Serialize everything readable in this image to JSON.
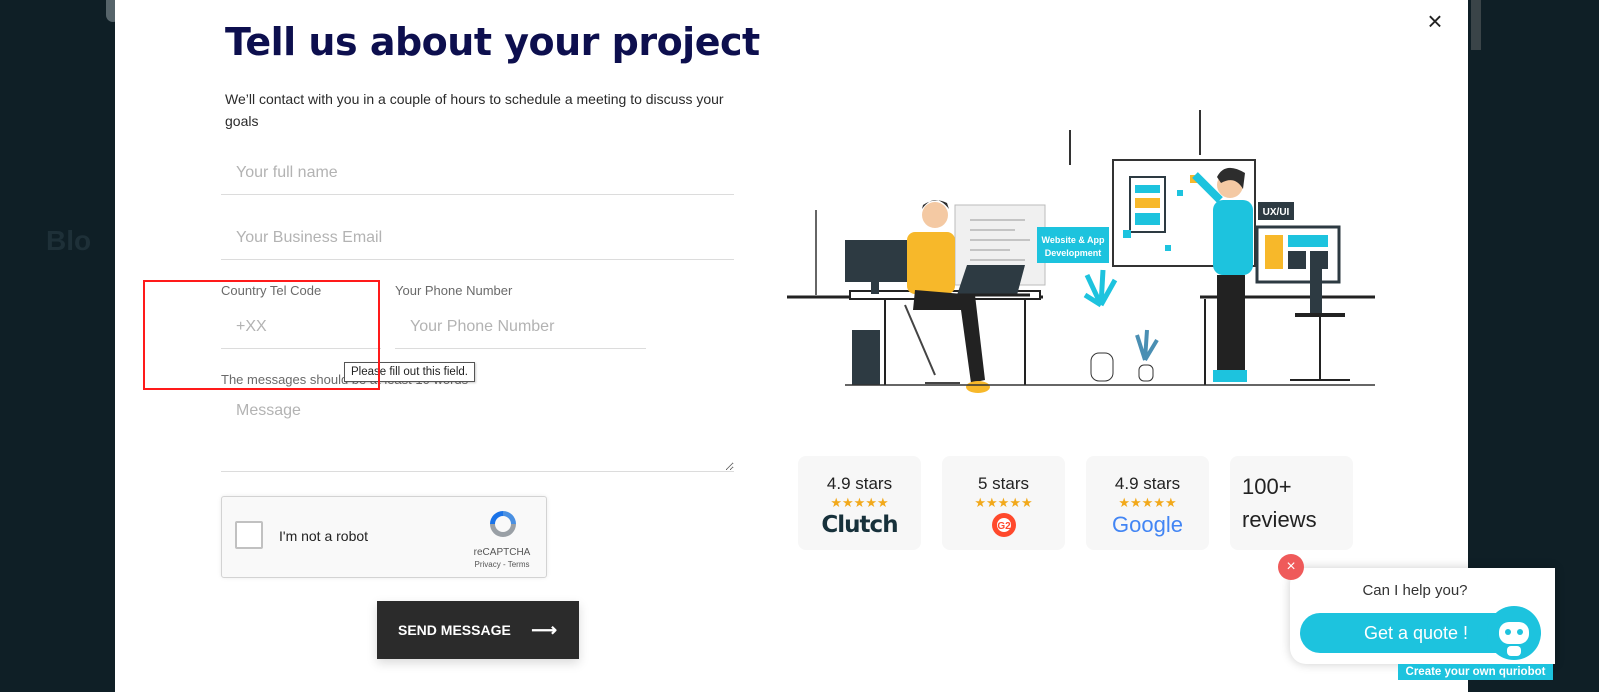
{
  "backdrop": {
    "partial_text": "Blo"
  },
  "modal": {
    "close_icon": "×",
    "title": "Tell us about your project",
    "subtitle": "We’ll contact with you in a couple of hours to schedule a meeting to discuss your goals"
  },
  "form": {
    "full_name_placeholder": "Your full name",
    "email_placeholder": "Your Business Email",
    "country_code_label": "Country Tel Code",
    "country_code_placeholder": "+XX",
    "phone_label": "Your Phone Number",
    "phone_placeholder": "Your Phone Number",
    "message_label": "The messages should be at least 10 words",
    "message_placeholder": "Message",
    "validation_tooltip": "Please fill out this field.",
    "recaptcha": {
      "label": "I'm not a robot",
      "brand": "reCAPTCHA",
      "links": "Privacy - Terms"
    },
    "submit_label": "SEND MESSAGE",
    "submit_arrow": "⟶"
  },
  "illustration": {
    "badge_text_line1": "Website & App",
    "badge_text_line2": "Development",
    "tag_uxui": "UX/UI"
  },
  "ratings": [
    {
      "stars_text": "4.9 stars",
      "stars": "★★★★★",
      "brand": "Clutch"
    },
    {
      "stars_text": "5 stars",
      "stars": "★★★★★",
      "brand": "G2"
    },
    {
      "stars_text": "4.9 stars",
      "stars": "★★★★★",
      "brand": "Google"
    }
  ],
  "reviews": {
    "line1": "100+",
    "line2": "reviews"
  },
  "chat": {
    "close_icon": "×",
    "question": "Can I help you?",
    "button_label": "Get a quote !",
    "footer": "Create your own quriobot"
  },
  "colors": {
    "title": "#0d0f4e",
    "accent_cyan": "#1dc3de",
    "button_dark": "#2b2b2b",
    "star_gold": "#f2a91b",
    "highlight_red": "#ff1a1a",
    "illustration_yellow": "#f7b82a"
  }
}
